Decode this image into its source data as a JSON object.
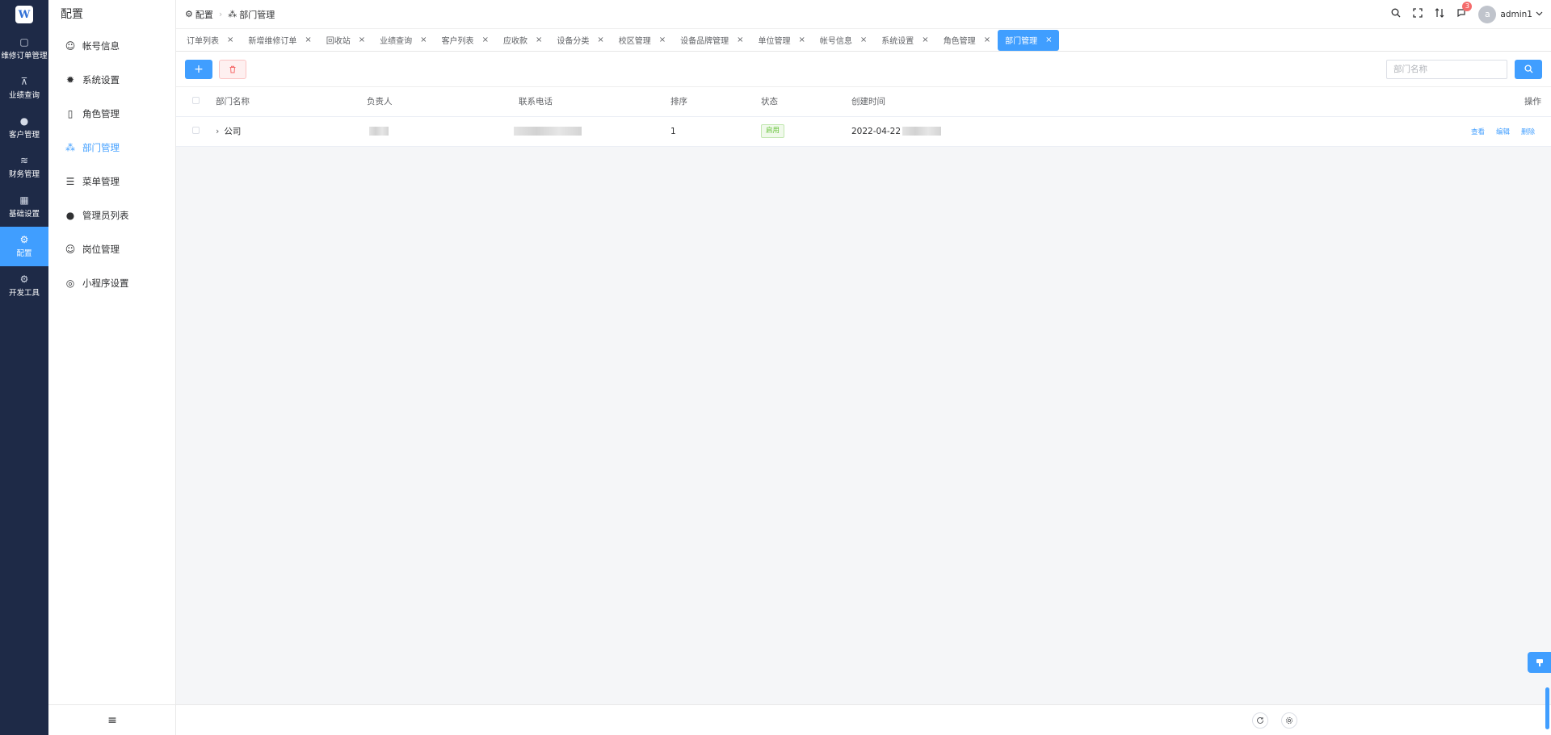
{
  "rail": {
    "logo_text": "W",
    "items": [
      {
        "label": "维修订单管理",
        "icon": "▢"
      },
      {
        "label": "业绩查询",
        "icon": "⊼"
      },
      {
        "label": "客户管理",
        "icon": "●"
      },
      {
        "label": "财务管理",
        "icon": "≋"
      },
      {
        "label": "基础设置",
        "icon": "▦"
      },
      {
        "label": "配置",
        "icon": "⚙"
      },
      {
        "label": "开发工具",
        "icon": "⚙"
      }
    ]
  },
  "menu": {
    "title": "配置",
    "items": [
      {
        "label": "帐号信息",
        "icon": "☺"
      },
      {
        "label": "系统设置",
        "icon": "✹"
      },
      {
        "label": "角色管理",
        "icon": "▯"
      },
      {
        "label": "部门管理",
        "icon": "⁂"
      },
      {
        "label": "菜单管理",
        "icon": "☰"
      },
      {
        "label": "管理员列表",
        "icon": "●"
      },
      {
        "label": "岗位管理",
        "icon": "☺"
      },
      {
        "label": "小程序设置",
        "icon": "◎"
      }
    ],
    "collapse_icon": "≡"
  },
  "header": {
    "breadcrumb": [
      {
        "label": "配置",
        "icon": "⚙"
      },
      {
        "label": "部门管理",
        "icon": "⁂"
      }
    ],
    "breadcrumb_sep": "›",
    "badge_count": "3",
    "user": {
      "avatar": "a",
      "name": "admin1"
    }
  },
  "tabs": [
    "订单列表",
    "新增维修订单",
    "回收站",
    "业绩查询",
    "客户列表",
    "应收款",
    "设备分类",
    "校区管理",
    "设备品牌管理",
    "单位管理",
    "帐号信息",
    "系统设置",
    "角色管理",
    "部门管理"
  ],
  "tab_close": "×",
  "toolbar": {
    "add_label": "+",
    "delete_icon": "🗑",
    "search_placeholder": "部门名称",
    "search_icon": "⌕"
  },
  "table": {
    "columns": [
      "部门名称",
      "负责人",
      "联系电话",
      "排序",
      "状态",
      "创建时间",
      "操作"
    ],
    "rows": [
      {
        "name": "公司",
        "sort": "1",
        "status": "启用",
        "created": "2022-04-22",
        "actions": [
          "查看",
          "编辑",
          "删除"
        ]
      }
    ]
  },
  "colors": {
    "accent": "#409eff",
    "rail_bg": "#1e2a47",
    "success": "#67c23a",
    "danger": "#f56c6c"
  }
}
